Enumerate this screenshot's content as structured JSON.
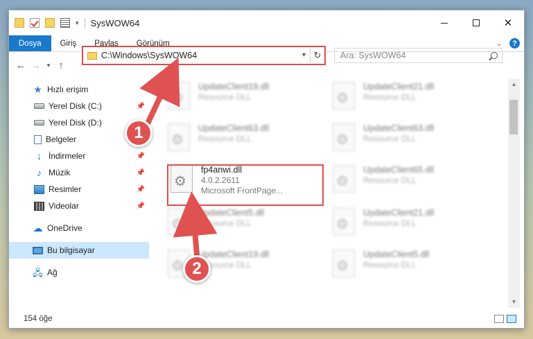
{
  "window": {
    "title": "SysWOW64"
  },
  "ribbon": {
    "tabs": [
      "Dosya",
      "Giriş",
      "Paylaş",
      "Görünüm"
    ]
  },
  "address": {
    "path": "C:\\Windows\\SysWOW64"
  },
  "search": {
    "placeholder": "Ara: SysWOW64"
  },
  "sidebar": {
    "quick_access": "Hızlı erişim",
    "items": [
      "Yerel Disk (C:)",
      "Yerel Disk (D:)",
      "Belgeler",
      "İndirmeler",
      "Müzik",
      "Resimler",
      "Videolar"
    ],
    "onedrive": "OneDrive",
    "this_pc": "Bu bilgisayar",
    "network": "Ağ"
  },
  "files": [
    {
      "name": "UpdateClient19.dll",
      "desc": "Resource DLL"
    },
    {
      "name": "UpdateClient21.dll",
      "desc": "Resource DLL"
    },
    {
      "name": "UpdateClient63.dll",
      "desc": "Resource DLL"
    },
    {
      "name": "UpdateClient63.dll",
      "desc": "Resource DLL"
    },
    {
      "name": "fp4anwi.dll",
      "version": "4.0.2.2611",
      "desc": "Microsoft FrontPage..."
    },
    {
      "name": "UpdateClient65.dll",
      "desc": "Resource DLL"
    },
    {
      "name": "UpdateClient5.dll",
      "desc": "Resource DLL"
    },
    {
      "name": "UpdateClient21.dll",
      "desc": "Resource DLL"
    },
    {
      "name": "UpdateClient19.dll",
      "desc": "Resource DLL"
    },
    {
      "name": "UpdateClient5.dll",
      "desc": "Resource DLL"
    }
  ],
  "status": {
    "count": "154 öğe"
  },
  "callouts": [
    "1",
    "2"
  ]
}
